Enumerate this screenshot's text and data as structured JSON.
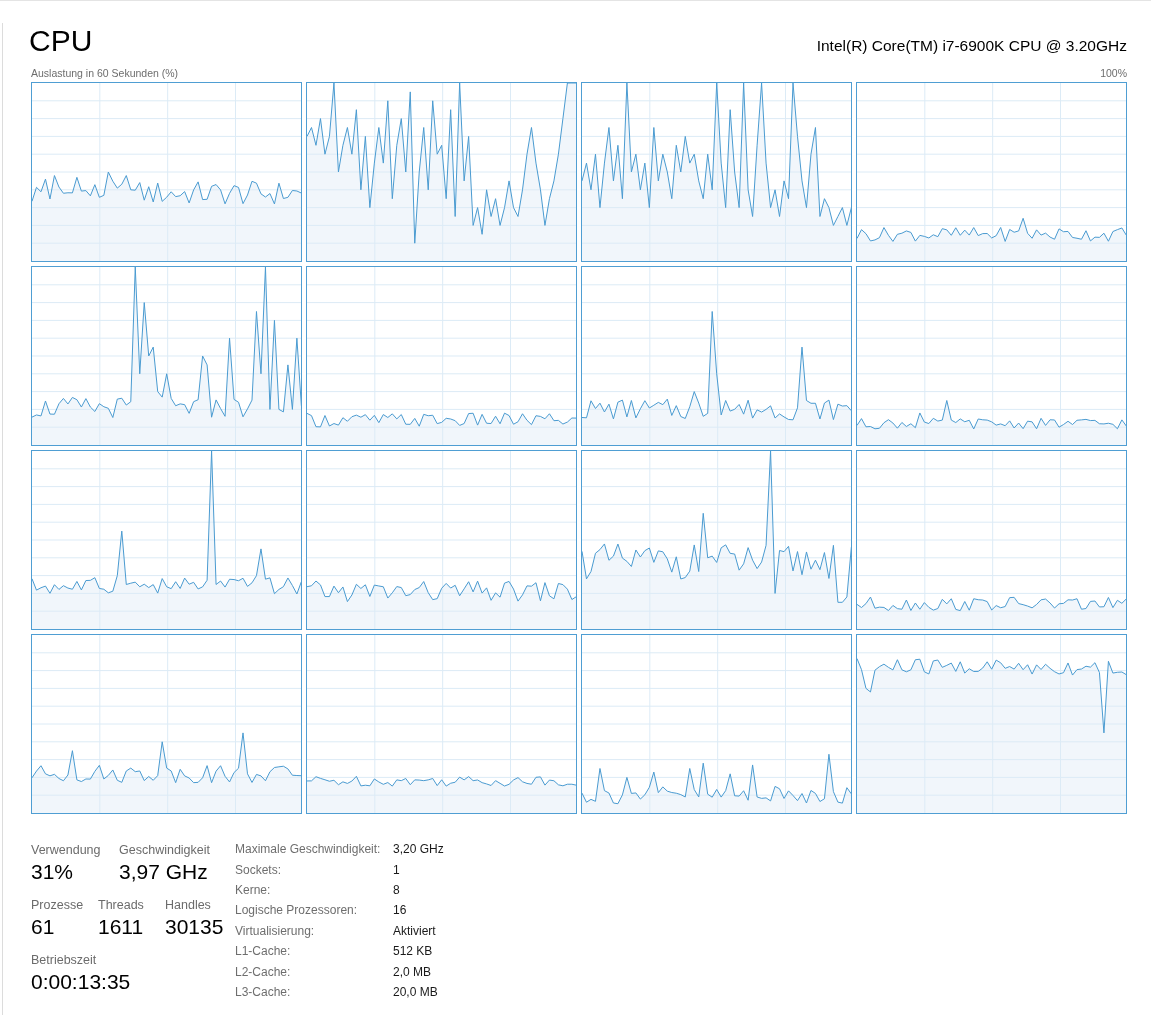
{
  "header": {
    "title": "CPU",
    "cpu_name": "Intel(R) Core(TM) i7-6900K CPU @ 3.20GHz"
  },
  "graph_area": {
    "caption": "Auslastung in 60 Sekunden (%)",
    "max_label": "100%"
  },
  "stat_rows": [
    [
      {
        "label": "Verwendung",
        "value": "31%"
      },
      {
        "label": "Geschwindigkeit",
        "value": "3,97 GHz"
      }
    ],
    [
      {
        "label": "Prozesse",
        "value": "61"
      },
      {
        "label": "Threads",
        "value": "1611"
      },
      {
        "label": "Handles",
        "value": "30135"
      }
    ],
    [
      {
        "label": "Betriebszeit",
        "value": "0:00:13:35"
      }
    ]
  ],
  "details": [
    {
      "label": "Maximale Geschwindigkeit:",
      "value": "3,20 GHz"
    },
    {
      "label": "Sockets:",
      "value": "1"
    },
    {
      "label": "Kerne:",
      "value": "8"
    },
    {
      "label": "Logische Prozessoren:",
      "value": "16"
    },
    {
      "label": "Virtualisierung:",
      "value": "Aktiviert"
    },
    {
      "label": "L1-Cache:",
      "value": "512 KB"
    },
    {
      "label": "L2-Cache:",
      "value": "2,0 MB"
    },
    {
      "label": "L3-Cache:",
      "value": "20,0 MB"
    }
  ]
}
